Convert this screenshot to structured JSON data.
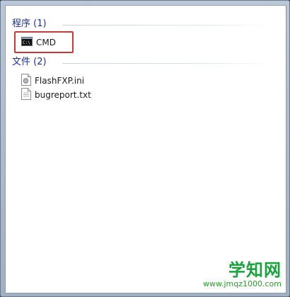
{
  "results": {
    "programs": {
      "header": "程序 (1)",
      "items": [
        {
          "label": "CMD",
          "icon": "cmd-icon"
        }
      ]
    },
    "files": {
      "header": "文件 (2)",
      "items": [
        {
          "label": "FlashFXP.ini",
          "icon": "config-file-icon"
        },
        {
          "label": "bugreport.txt",
          "icon": "text-file-icon"
        }
      ]
    }
  },
  "watermark": {
    "title": "学知网",
    "url": "www.jmqz1000.com"
  },
  "colors": {
    "group_header": "#1e3287",
    "highlight_box": "#c8393c",
    "watermark": "#18a23c"
  }
}
